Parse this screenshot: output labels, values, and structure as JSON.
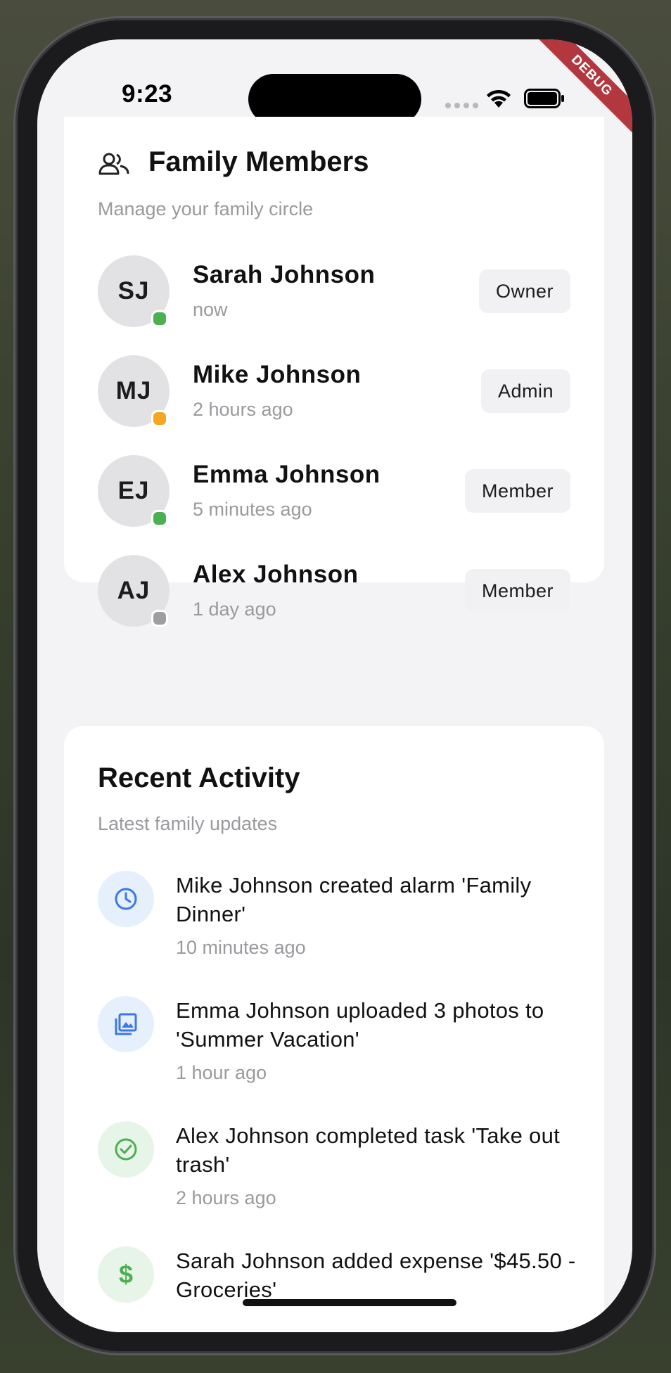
{
  "status_bar": {
    "time": "9:23",
    "debug_label": "DEBUG"
  },
  "members_card": {
    "title": "Family Members",
    "subtitle": "Manage your family circle",
    "members": [
      {
        "initials": "SJ",
        "name": "Sarah Johnson",
        "last_seen": "now",
        "role": "Owner",
        "presence_color": "#4caf50"
      },
      {
        "initials": "MJ",
        "name": "Mike Johnson",
        "last_seen": "2 hours ago",
        "role": "Admin",
        "presence_color": "#f5a623"
      },
      {
        "initials": "EJ",
        "name": "Emma Johnson",
        "last_seen": "5 minutes ago",
        "role": "Member",
        "presence_color": "#4caf50"
      },
      {
        "initials": "AJ",
        "name": "Alex Johnson",
        "last_seen": "1 day ago",
        "role": "Member",
        "presence_color": "#9e9e9e"
      }
    ]
  },
  "activity_card": {
    "title": "Recent Activity",
    "subtitle": "Latest family updates",
    "items": [
      {
        "icon": "clock-icon",
        "color": "#3b78e7",
        "bg": "#e6f0fd",
        "text": "Mike Johnson created alarm 'Family Dinner'",
        "time": "10 minutes ago"
      },
      {
        "icon": "photo-library-icon",
        "color": "#3b78e7",
        "bg": "#e6f0fd",
        "text": "Emma Johnson uploaded 3 photos to 'Summer Vacation'",
        "time": "1 hour ago"
      },
      {
        "icon": "check-circle-icon",
        "color": "#4caf50",
        "bg": "#e7f5e8",
        "text": "Alex Johnson completed task 'Take out trash'",
        "time": "2 hours ago"
      },
      {
        "icon": "dollar-icon",
        "color": "#4caf50",
        "bg": "#e7f5e8",
        "text": "Sarah Johnson added expense '$45.50 - Groceries'",
        "time": ""
      }
    ]
  }
}
